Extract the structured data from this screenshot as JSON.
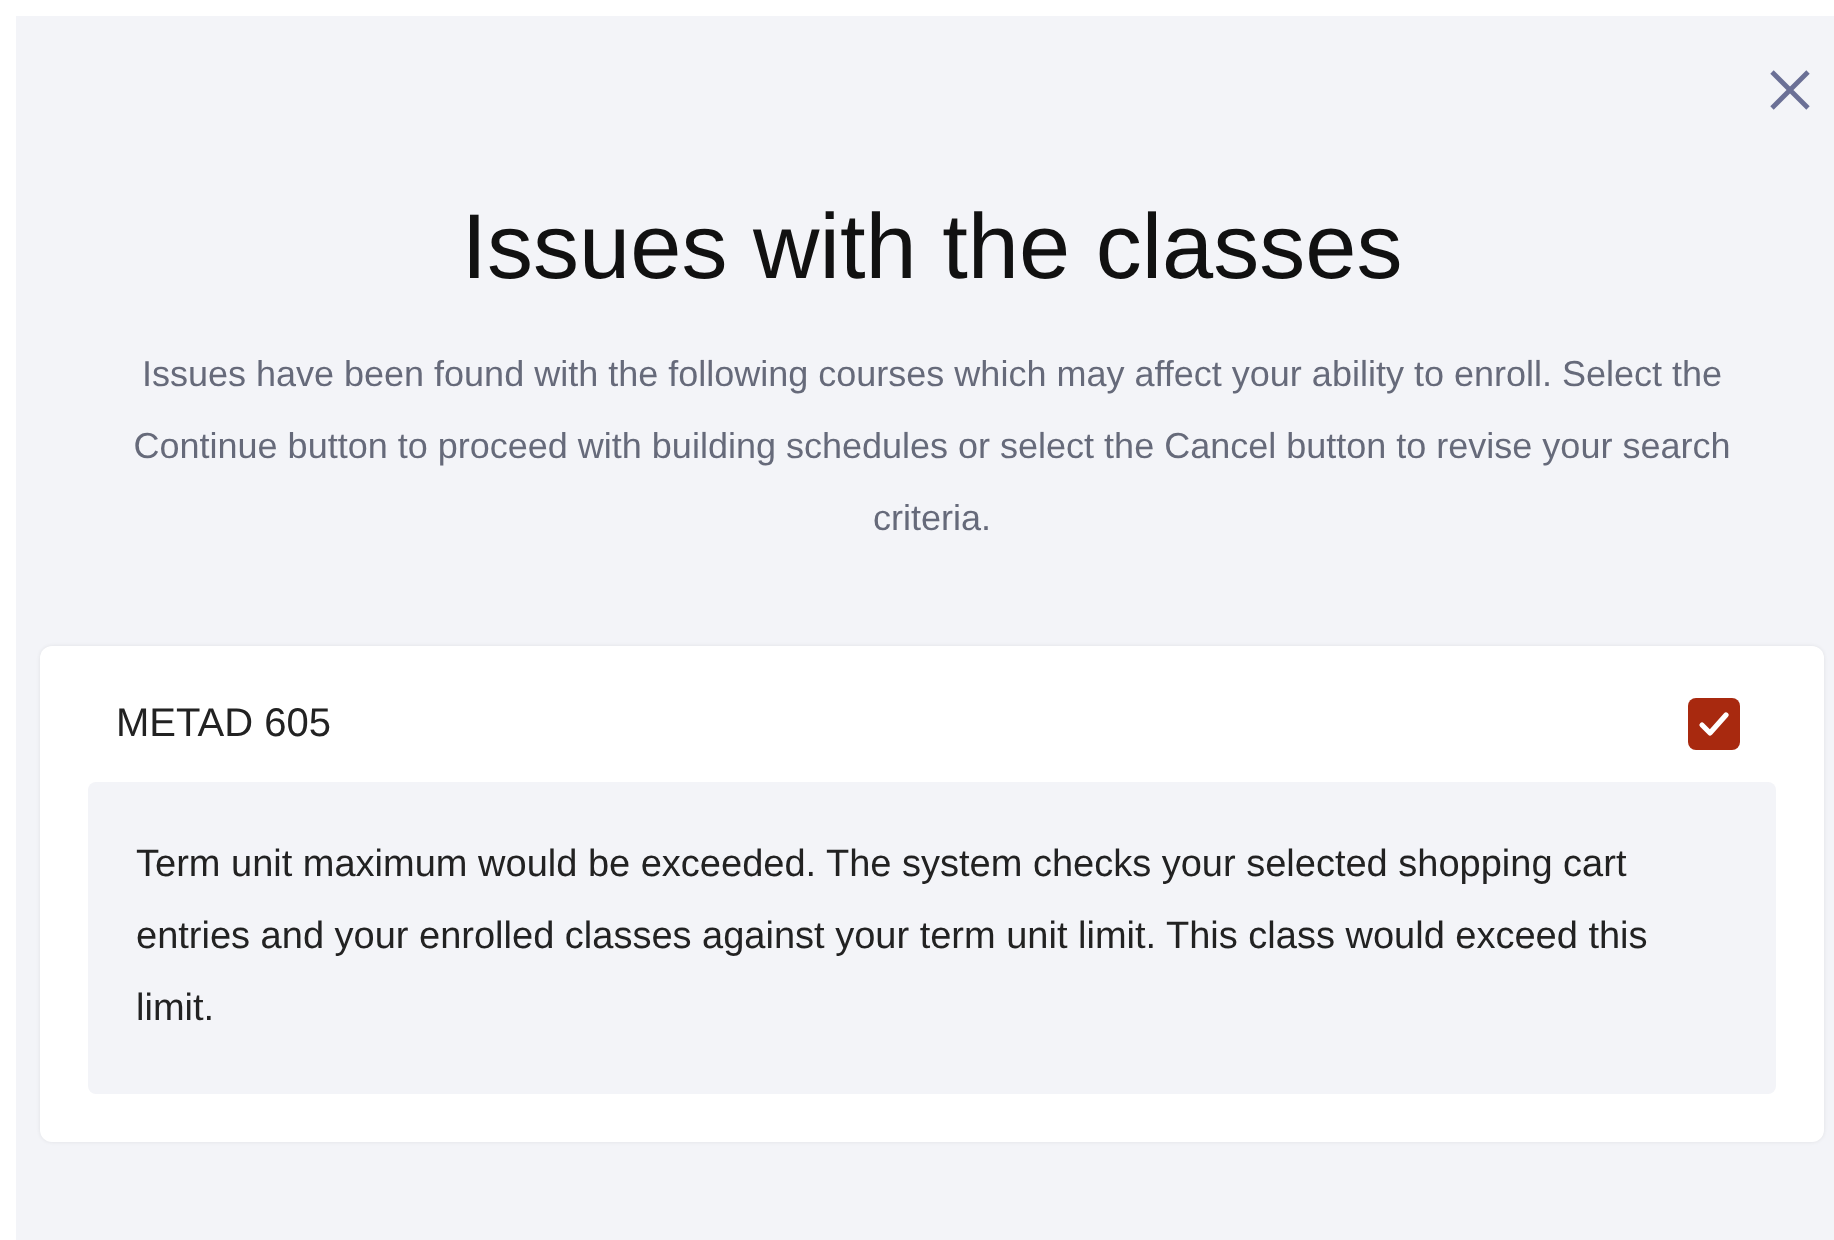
{
  "dialog": {
    "title": "Issues with the classes",
    "description": "Issues have been found with the following courses which may affect your ability to enroll. Select the Continue button to proceed with building schedules or select the Cancel button to revise your search criteria."
  },
  "courses": [
    {
      "name": "METAD 605",
      "checked": true,
      "message": "Term unit maximum would be exceeded. The system checks your selected shopping cart entries and your enrolled classes against your term unit limit. This class would exceed this limit."
    }
  ]
}
